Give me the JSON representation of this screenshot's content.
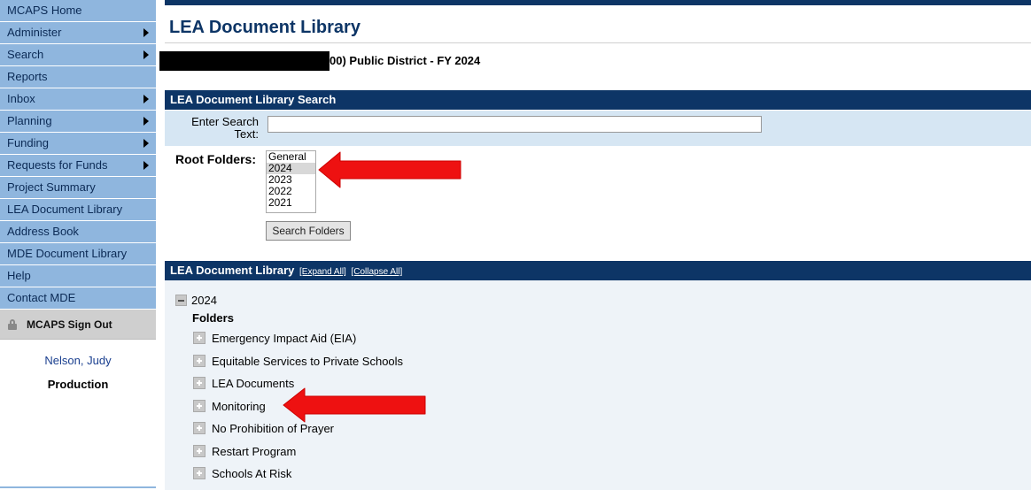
{
  "sidebar": {
    "items": [
      {
        "label": "MCAPS Home",
        "has_submenu": false
      },
      {
        "label": "Administer",
        "has_submenu": true
      },
      {
        "label": "Search",
        "has_submenu": true
      },
      {
        "label": "Reports",
        "has_submenu": false
      },
      {
        "label": "Inbox",
        "has_submenu": true
      },
      {
        "label": "Planning",
        "has_submenu": true
      },
      {
        "label": "Funding",
        "has_submenu": true
      },
      {
        "label": "Requests for Funds",
        "has_submenu": true
      },
      {
        "label": "Project Summary",
        "has_submenu": false
      },
      {
        "label": "LEA Document Library",
        "has_submenu": false
      },
      {
        "label": "Address Book",
        "has_submenu": false
      },
      {
        "label": "MDE Document Library",
        "has_submenu": false
      },
      {
        "label": "Help",
        "has_submenu": false
      },
      {
        "label": "Contact MDE",
        "has_submenu": false
      }
    ],
    "signout_label": "MCAPS Sign Out",
    "user_name": "Nelson, Judy",
    "environment": "Production"
  },
  "main": {
    "title": "LEA Document Library",
    "district": "00) Public District - FY 2024",
    "search_section": {
      "header": "LEA Document Library Search",
      "search_label": "Enter Search Text:",
      "search_value": "",
      "root_folders_label": "Root Folders:",
      "root_folders": [
        "General",
        "2024",
        "2023",
        "2022",
        "2021"
      ],
      "selected_root": "2024",
      "search_button": "Search Folders"
    },
    "library_section": {
      "header": "LEA Document Library",
      "expand_all": "[Expand All]",
      "collapse_all": "[Collapse All]",
      "year": "2024",
      "folders_label": "Folders",
      "folders": [
        "Emergency Impact Aid (EIA)",
        "Equitable Services to Private Schools",
        "LEA Documents",
        "Monitoring",
        "No Prohibition of Prayer",
        "Restart Program",
        "Schools At Risk"
      ]
    }
  },
  "colors": {
    "nav_bg": "#8fb6de",
    "header_navy": "#0d3566",
    "annotation_red": "#ee1111"
  }
}
